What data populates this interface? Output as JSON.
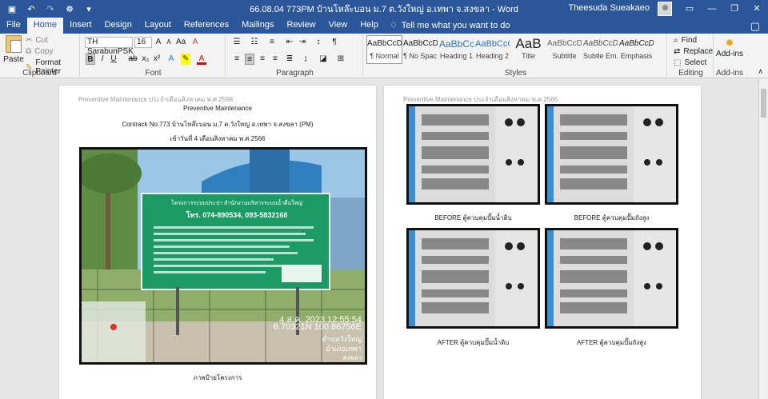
{
  "window": {
    "title": "66.08.04 773PM บ้านโหล๊ะบอน ม.7 ต.วังใหญ่ อ.เทพา จ.สงขลา - Word",
    "user": "Theesuda Sueakaeo"
  },
  "tabs": [
    "File",
    "Home",
    "Insert",
    "Design",
    "Layout",
    "References",
    "Mailings",
    "Review",
    "View",
    "Help"
  ],
  "tell_me": "Tell me what you want to do",
  "ribbon": {
    "clipboard": {
      "label": "Clipboard",
      "paste": "Paste",
      "cut": "Cut",
      "copy": "Copy",
      "format_painter": "Format Painter"
    },
    "font": {
      "label": "Font",
      "name": "TH SarabunPSK",
      "size": "16"
    },
    "paragraph": {
      "label": "Paragraph"
    },
    "styles": {
      "label": "Styles",
      "items": [
        {
          "preview": "AaBbCcDd",
          "name": "¶ Normal"
        },
        {
          "preview": "AaBbCcDd",
          "name": "¶ No Spac..."
        },
        {
          "preview": "AaBbCc",
          "name": "Heading 1"
        },
        {
          "preview": "AaBbCcC",
          "name": "Heading 2"
        },
        {
          "preview": "AaB",
          "name": "Title"
        },
        {
          "preview": "AaBbCcDd",
          "name": "Subtitle"
        },
        {
          "preview": "AaBbCcDd",
          "name": "Subtle Em..."
        },
        {
          "preview": "AaBbCcDd",
          "name": "Emphasis"
        }
      ]
    },
    "editing": {
      "label": "Editing",
      "find": "Find",
      "replace": "Replace",
      "select": "Select"
    },
    "addins": {
      "label": "Add-ins",
      "button": "Add-ins"
    }
  },
  "page1": {
    "header": "Preventive Maintenance ประจำเดือนสิงหาคม พ.ศ.2566",
    "title": "Preventive Maintenance",
    "contract": "Contrack No.773 บ้านโหล๊ะบอน ม.7 ต.วังใหญ่ อ.เทพา จ.สงขลา (PM)",
    "date": "เข้าวันที่ 4 เดือนสิงหาคม พ.ศ.2566",
    "photo": {
      "sign_line1": "โครงการระบบประปา สำนักงานบริหารระบบน้ำดื่มใหญ่",
      "sign_phone": "โทร. 074-890534, 093-5832168",
      "stamp_date": "4 ส.ค. 2023 12:55:54",
      "stamp_coords": "6.70321N 100.86756E",
      "stamp_place": "ตำบลวังใหญ่",
      "stamp_district": "อำเภอเทพา",
      "stamp_province": "สงขลา"
    },
    "caption": "ภาพป้ายโครงการ"
  },
  "page2": {
    "header": "Preventive Maintenance ประจำเดือนสิงหาคม พ.ศ.2566",
    "captions": [
      "BEFORE ตู้ควบคุมปั๊มน้ำดิบ",
      "BEFORE ตู้ควบคุมปั๊มถังสูง",
      "AFTER ตู้ควบคุมปั๊มน้ำดิบ",
      "AFTER ตู้ควบคุมปั๊มถังสูง"
    ]
  },
  "colors": {
    "word_blue": "#2b579a",
    "ribbon_bg": "#f3f3f3",
    "canvas_bg": "#e6e6e6"
  }
}
